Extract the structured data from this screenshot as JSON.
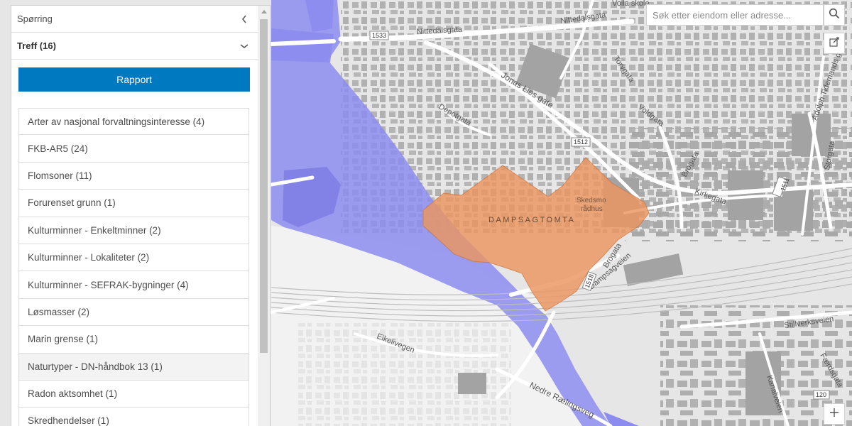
{
  "panel": {
    "title": "Spørring",
    "results_label": "Treff (16)",
    "report_button": "Rapport"
  },
  "layers": [
    "Arter av nasjonal forvaltningsinteresse (4)",
    "FKB-AR5 (24)",
    "Flomsoner (11)",
    "Forurenset grunn (1)",
    "Kulturminner - Enkeltminner (2)",
    "Kulturminner - Lokaliteter (2)",
    "Kulturminner - SEFRAK-bygninger (4)",
    "Løsmasser (2)",
    "Marin grense (1)",
    "Naturtyper - DN-håndbok 13 (1)",
    "Radon aktsomhet (1)",
    "Skredhendelser (1)"
  ],
  "search": {
    "placeholder": "Søk etter eiendom eller adresse..."
  },
  "map": {
    "streets": {
      "nittedalsgata_1": "Nittedalsgata",
      "nittedalsgata_2": "Nittedalsgata",
      "jonas_lies_gate": "Jonas Lies gate",
      "depotgata": "Depotgata",
      "torvgata": "Torvgata",
      "voldgata": "Voldgata",
      "brogata_1": "Brogata",
      "brogata_2": "Brogata",
      "kirkegata": "Kirkegata",
      "storgata": "Storgata",
      "adolph_tidemands_gate": "Adolph Tidemands gate",
      "dampsagveien": "Dampsagveien",
      "eikelivegen": "Eikelivegen",
      "nedre_raelingsveg": "Nedre Rælingsveg",
      "stillverksveien": "Stillverksveien",
      "faerdsgata": "Færdsgata",
      "kanalveien": "Kanalveien",
      "volla_skole": "Volla skole"
    },
    "place_label": "DAMPSAGTOMTA",
    "building_label_1": "Skedsmo",
    "building_label_2": "rådhus",
    "road_shields": [
      "1533",
      "1512",
      "1511",
      "1518",
      "120"
    ],
    "colors": {
      "flood_zone": "#8c8cf0",
      "property": "#eb9660",
      "buildings": "#a6a6a6",
      "roads": "#ffffff"
    }
  },
  "icons": {
    "collapse": "chevron-left-icon",
    "expand": "chevron-down-icon",
    "search": "search-icon",
    "tool": "edit-map-icon",
    "zoom": "plus-icon"
  }
}
